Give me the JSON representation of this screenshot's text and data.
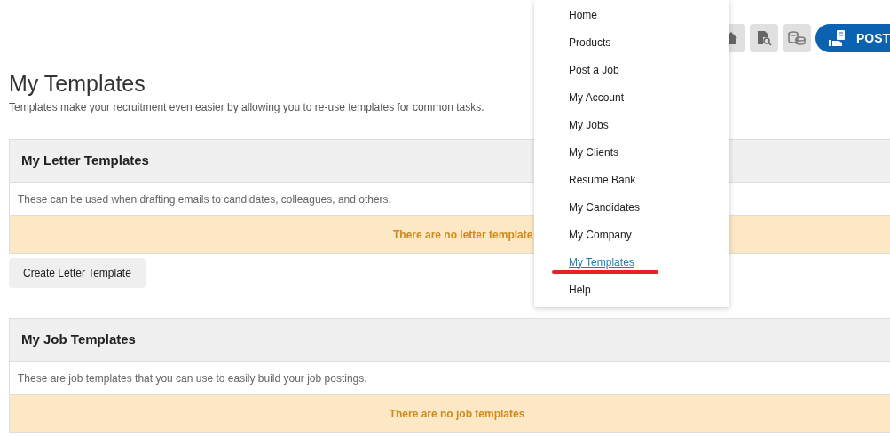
{
  "toolbar": {
    "post_button": {
      "label": "POST"
    }
  },
  "page": {
    "title": "My Templates",
    "subtitle": "Templates make your recruitment even easier by allowing you to re-use templates for common tasks."
  },
  "sections": [
    {
      "title": "My Letter Templates",
      "description": "These can be used when drafting emails to candidates, colleagues, and others.",
      "notice": "There are no letter template",
      "button": "Create Letter Template"
    },
    {
      "title": "My Job Templates",
      "description": "These are job templates that you can use to easily build your job postings.",
      "notice": "There are no job templates"
    }
  ],
  "menu": {
    "items": [
      {
        "label": "Home",
        "selected": false
      },
      {
        "label": "Products",
        "selected": false
      },
      {
        "label": "Post a Job",
        "selected": false
      },
      {
        "label": "My Account",
        "selected": false
      },
      {
        "label": "My Jobs",
        "selected": false
      },
      {
        "label": "My Clients",
        "selected": false
      },
      {
        "label": "Resume Bank",
        "selected": false
      },
      {
        "label": "My Candidates",
        "selected": false
      },
      {
        "label": "My Company",
        "selected": false
      },
      {
        "label": "My Templates",
        "selected": true
      },
      {
        "label": "Help",
        "selected": false
      }
    ]
  }
}
